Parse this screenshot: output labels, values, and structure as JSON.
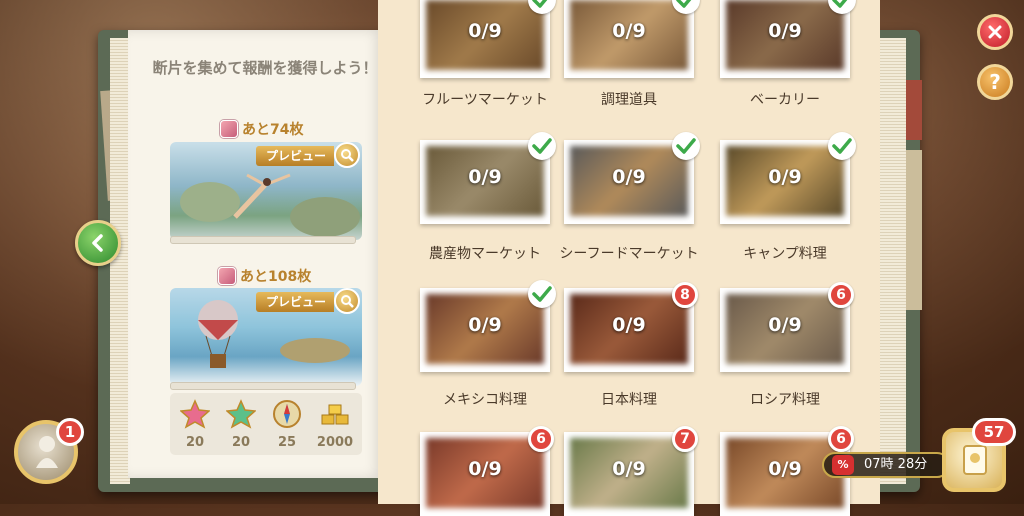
{
  "left_page": {
    "intro": "断片を集めて報酬を獲得しよう！",
    "rewards": [
      {
        "remaining_label": "あと74枚",
        "preview_label": "プレビュー"
      },
      {
        "remaining_label": "あと108枚",
        "preview_label": "プレビュー"
      }
    ],
    "bottom_rewards": [
      {
        "icon": "pink-star-icon",
        "value": "20"
      },
      {
        "icon": "green-star-icon",
        "value": "20"
      },
      {
        "icon": "compass-icon",
        "value": "25"
      },
      {
        "icon": "gold-bars-icon",
        "value": "2000"
      }
    ]
  },
  "categories": [
    {
      "name": "フルーツマーケット",
      "count": "0/9",
      "status": "complete"
    },
    {
      "name": "調理道具",
      "count": "0/9",
      "status": "complete"
    },
    {
      "name": "ベーカリー",
      "count": "0/9",
      "status": "complete"
    },
    {
      "name": "農産物マーケット",
      "count": "0/9",
      "status": "complete"
    },
    {
      "name": "シーフードマーケット",
      "count": "0/9",
      "status": "complete"
    },
    {
      "name": "キャンプ料理",
      "count": "0/9",
      "status": "complete"
    },
    {
      "name": "メキシコ料理",
      "count": "0/9",
      "status": "complete"
    },
    {
      "name": "日本料理",
      "count": "0/9",
      "status": "8"
    },
    {
      "name": "ロシア料理",
      "count": "0/9",
      "status": "6"
    },
    {
      "name": "",
      "count": "0/9",
      "status": "6"
    },
    {
      "name": "",
      "count": "0/9",
      "status": "7"
    },
    {
      "name": "",
      "count": "0/9",
      "status": "6"
    }
  ],
  "hud": {
    "help_label": "?",
    "profile_badge": "1",
    "inventory_badge": "57",
    "timer_icon": "%",
    "timer": "07時 28分"
  },
  "colors": {
    "accent_gold": "#b8822e",
    "badge_red": "#e0463e",
    "check_green": "#3daa4a"
  }
}
